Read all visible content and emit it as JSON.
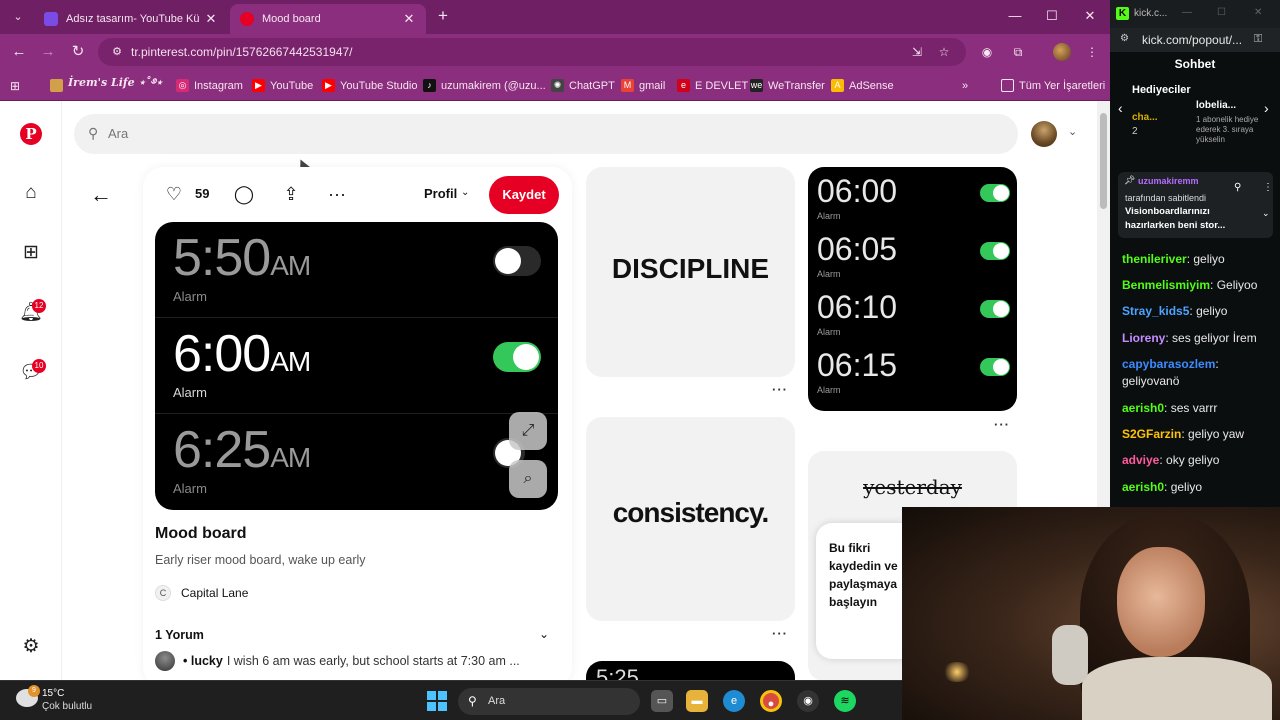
{
  "browser": {
    "tabs": [
      {
        "title": "Adsız tasarım- YouTube Küçük Resmi",
        "active": false,
        "favicon_color": "#7b4ce5"
      },
      {
        "title": "Mood board",
        "active": true,
        "favicon_color": "#e60023"
      }
    ],
    "url": "tr.pinterest.com/pin/15762667442531947/",
    "bookmarks": [
      {
        "label": "İrem's Life ⋆˚࿔⋆",
        "icon": "profile-icon",
        "color": "#d3a04a"
      },
      {
        "label": "Instagram",
        "icon": "instagram-icon",
        "color": "#d62976"
      },
      {
        "label": "YouTube",
        "icon": "youtube-icon",
        "color": "#ff0000"
      },
      {
        "label": "YouTube Studio",
        "icon": "youtube-studio-icon",
        "color": "#ff0000"
      },
      {
        "label": "uzumakirem (@uzu...",
        "icon": "tiktok-icon",
        "color": "#111111"
      },
      {
        "label": "ChatGPT",
        "icon": "chatgpt-icon",
        "color": "#444444"
      },
      {
        "label": "gmail",
        "icon": "gmail-icon",
        "color": "#ea4335"
      },
      {
        "label": "E DEVLET",
        "icon": "edevlet-icon",
        "color": "#d0021b"
      },
      {
        "label": "WeTransfer",
        "icon": "wetransfer-icon",
        "color": "#222222"
      },
      {
        "label": "AdSense",
        "icon": "adsense-icon",
        "color": "#fbbc04"
      }
    ],
    "all_bookmarks_label": "Tüm Yer İşaretleri"
  },
  "pinterest": {
    "search_placeholder": "Ara",
    "notification_badge": "12",
    "messages_badge": "10",
    "pin": {
      "likes": "59",
      "profile_dropdown": "Profil",
      "save_label": "Kaydet",
      "title": "Mood board",
      "description": "Early riser mood board, wake up early",
      "creator": "Capital Lane",
      "comments_header": "1 Yorum",
      "comment_user": "• lucky",
      "comment_text": "I wish 6 am was early, but school starts at 7:30 am ...",
      "alarms": [
        {
          "time": "5:50",
          "ampm": "AM",
          "label": "Alarm",
          "on": false
        },
        {
          "time": "6:00",
          "ampm": "AM",
          "label": "Alarm",
          "on": true
        },
        {
          "time": "6:25",
          "ampm": "AM",
          "label": "Alarm",
          "on": false
        }
      ]
    },
    "tiles": {
      "discipline": "DISCIPLINE",
      "consistency": "consistency.",
      "yesterday": "yesterday",
      "partial_time": "5:25"
    },
    "mini_alarms": [
      {
        "time": "06:00",
        "label": "Alarm"
      },
      {
        "time": "06:05",
        "label": "Alarm"
      },
      {
        "time": "06:10",
        "label": "Alarm"
      },
      {
        "time": "06:15",
        "label": "Alarm"
      }
    ],
    "save_popup_text": "Bu fikri kaydedin ve paylaşmaya başlayın"
  },
  "kick": {
    "tab_title": "kick.c...",
    "url": "kick.com/popout/...",
    "chat_title": "Sohbet",
    "gifters_title": "Hediyeciler",
    "gifter_a": "cha...",
    "gifter_a_count": "2",
    "gifter_b": "lobelia...",
    "gifter_b_count": "1",
    "gifter_b_note": "1 abonelik hediye ederek 3. sıraya yükselin",
    "pinned_user": "uzumakiremm",
    "pinned_by": "tarafından sabitlendi",
    "pinned_text": "Visionboardlarınızı hazırlarken beni stor...",
    "messages": [
      {
        "user": "thenileriver",
        "color": "#53fc18",
        "text": "geliyo"
      },
      {
        "user": "Benmelismiyim",
        "color": "#53fc18",
        "text": "Geliyoo"
      },
      {
        "user": "Stray_kids5",
        "color": "#4da3ff",
        "text": "geliyo"
      },
      {
        "user": "Lioreny",
        "color": "#c58cff",
        "text": "ses geliyor İrem"
      },
      {
        "user": "capybarasozlem",
        "color": "#3c8cff",
        "text": "geliyovanö"
      },
      {
        "user": "aerish0",
        "color": "#53fc18",
        "text": "ses varrr"
      },
      {
        "user": "S2GFarzin",
        "color": "#ffc400",
        "text": "geliyo yaw"
      },
      {
        "user": "adviye",
        "color": "#ff5aa0",
        "text": "oky geliyo"
      },
      {
        "user": "aerish0",
        "color": "#53fc18",
        "text": "geliyo"
      }
    ]
  },
  "taskbar": {
    "temperature": "15°C",
    "weather": "Çok bulutlu",
    "weather_badge": "9",
    "search_placeholder": "Ara"
  }
}
